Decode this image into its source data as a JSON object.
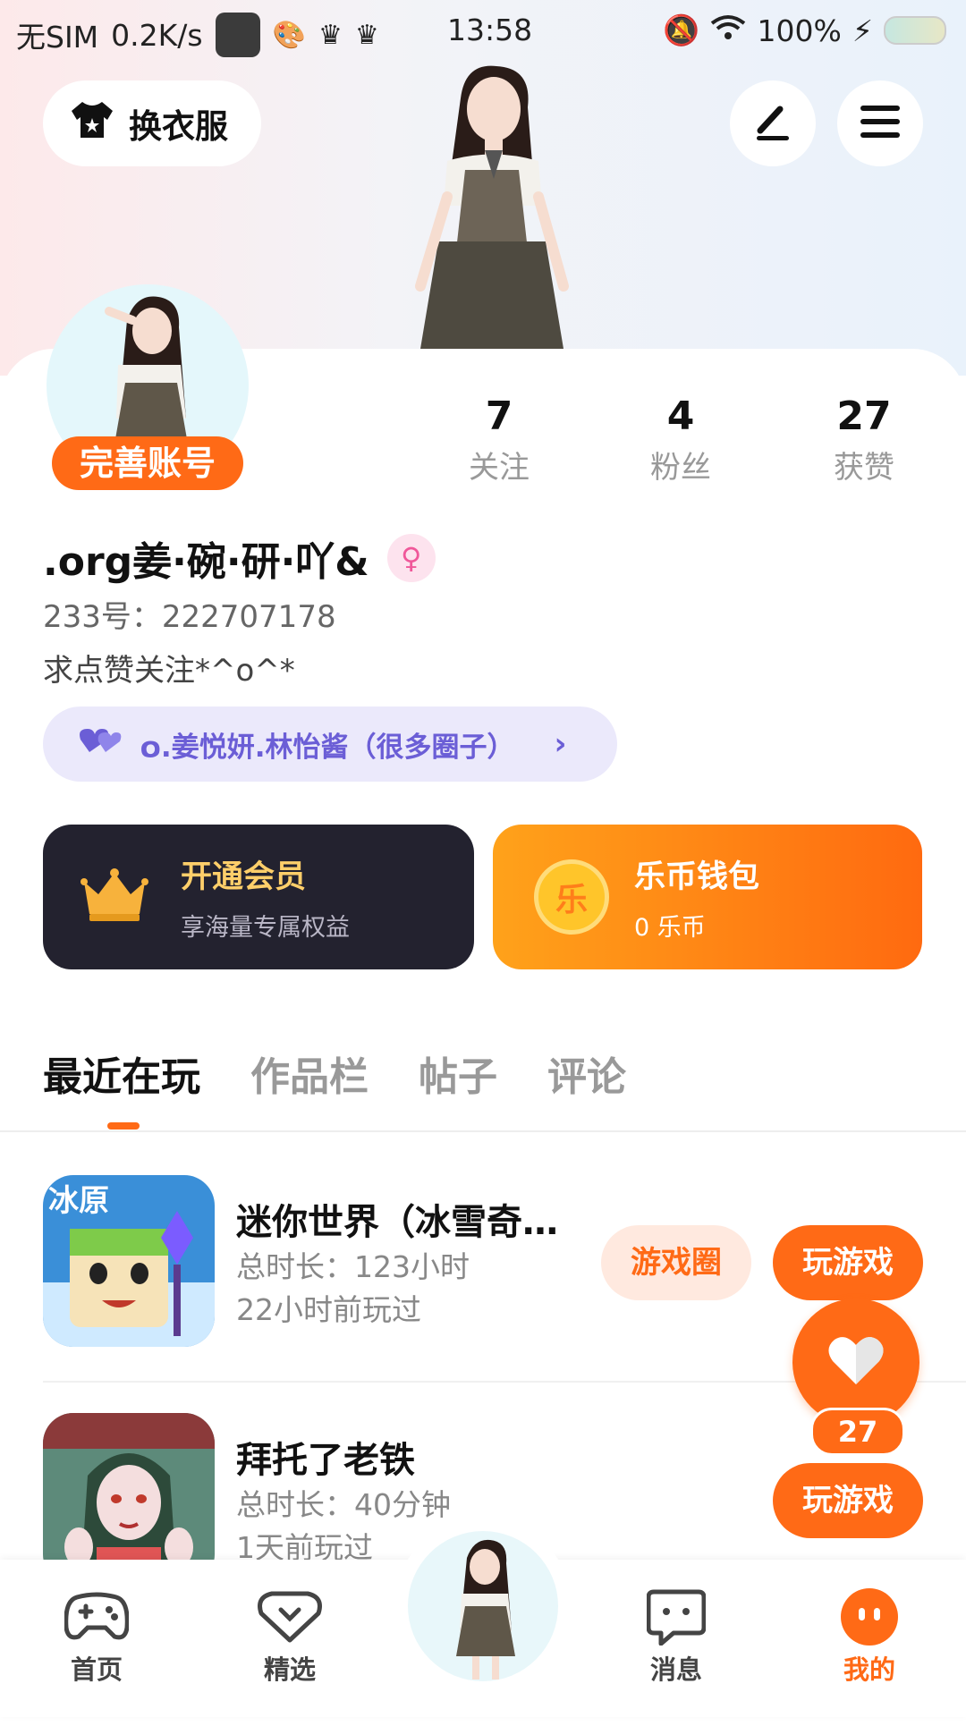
{
  "status_bar": {
    "carrier": "无SIM",
    "net_speed": "0.2K/s",
    "time": "13:58",
    "battery": "100%"
  },
  "top": {
    "dress_button": "换衣服"
  },
  "profile": {
    "badge": "完善账号",
    "stats": [
      {
        "num": "7",
        "label": "关注"
      },
      {
        "num": "4",
        "label": "粉丝"
      },
      {
        "num": "27",
        "label": "获赞"
      }
    ],
    "username": ".org姜·碗·研·吖&",
    "gender_symbol": "♀",
    "uid": "233号：222707178",
    "bio": "求点赞关注*^o^*",
    "circle": "໐.姜悦妍.林怡酱（很多圈子）",
    "circle_chevron": "›"
  },
  "cards": {
    "vip_title": "开通会员",
    "vip_sub": "享海量专属权益",
    "wallet_title": "乐币钱包",
    "wallet_sub": "0  乐币",
    "coin_char": "乐"
  },
  "tabs": [
    "最近在玩",
    "作品栏",
    "帖子",
    "评论"
  ],
  "games": [
    {
      "name": "迷你世界（冰雪奇…",
      "total": "总时长：123小时",
      "last": "22小时前玩过",
      "circle_btn": "游戏圈",
      "play_btn": "玩游戏",
      "icon_text": "冰原"
    },
    {
      "name": "拜托了老铁",
      "total": "总时长：40分钟",
      "last": "1天前玩过",
      "play_btn": "玩游戏"
    }
  ],
  "like_count": "27",
  "nav": {
    "home": "首页",
    "featured": "精选",
    "messages": "消息",
    "mine": "我的"
  },
  "colors": {
    "accent": "#ff6a16",
    "vip_bg": "#23222f",
    "gold": "#ffcf6a",
    "circle_text": "#6b5ed6"
  }
}
